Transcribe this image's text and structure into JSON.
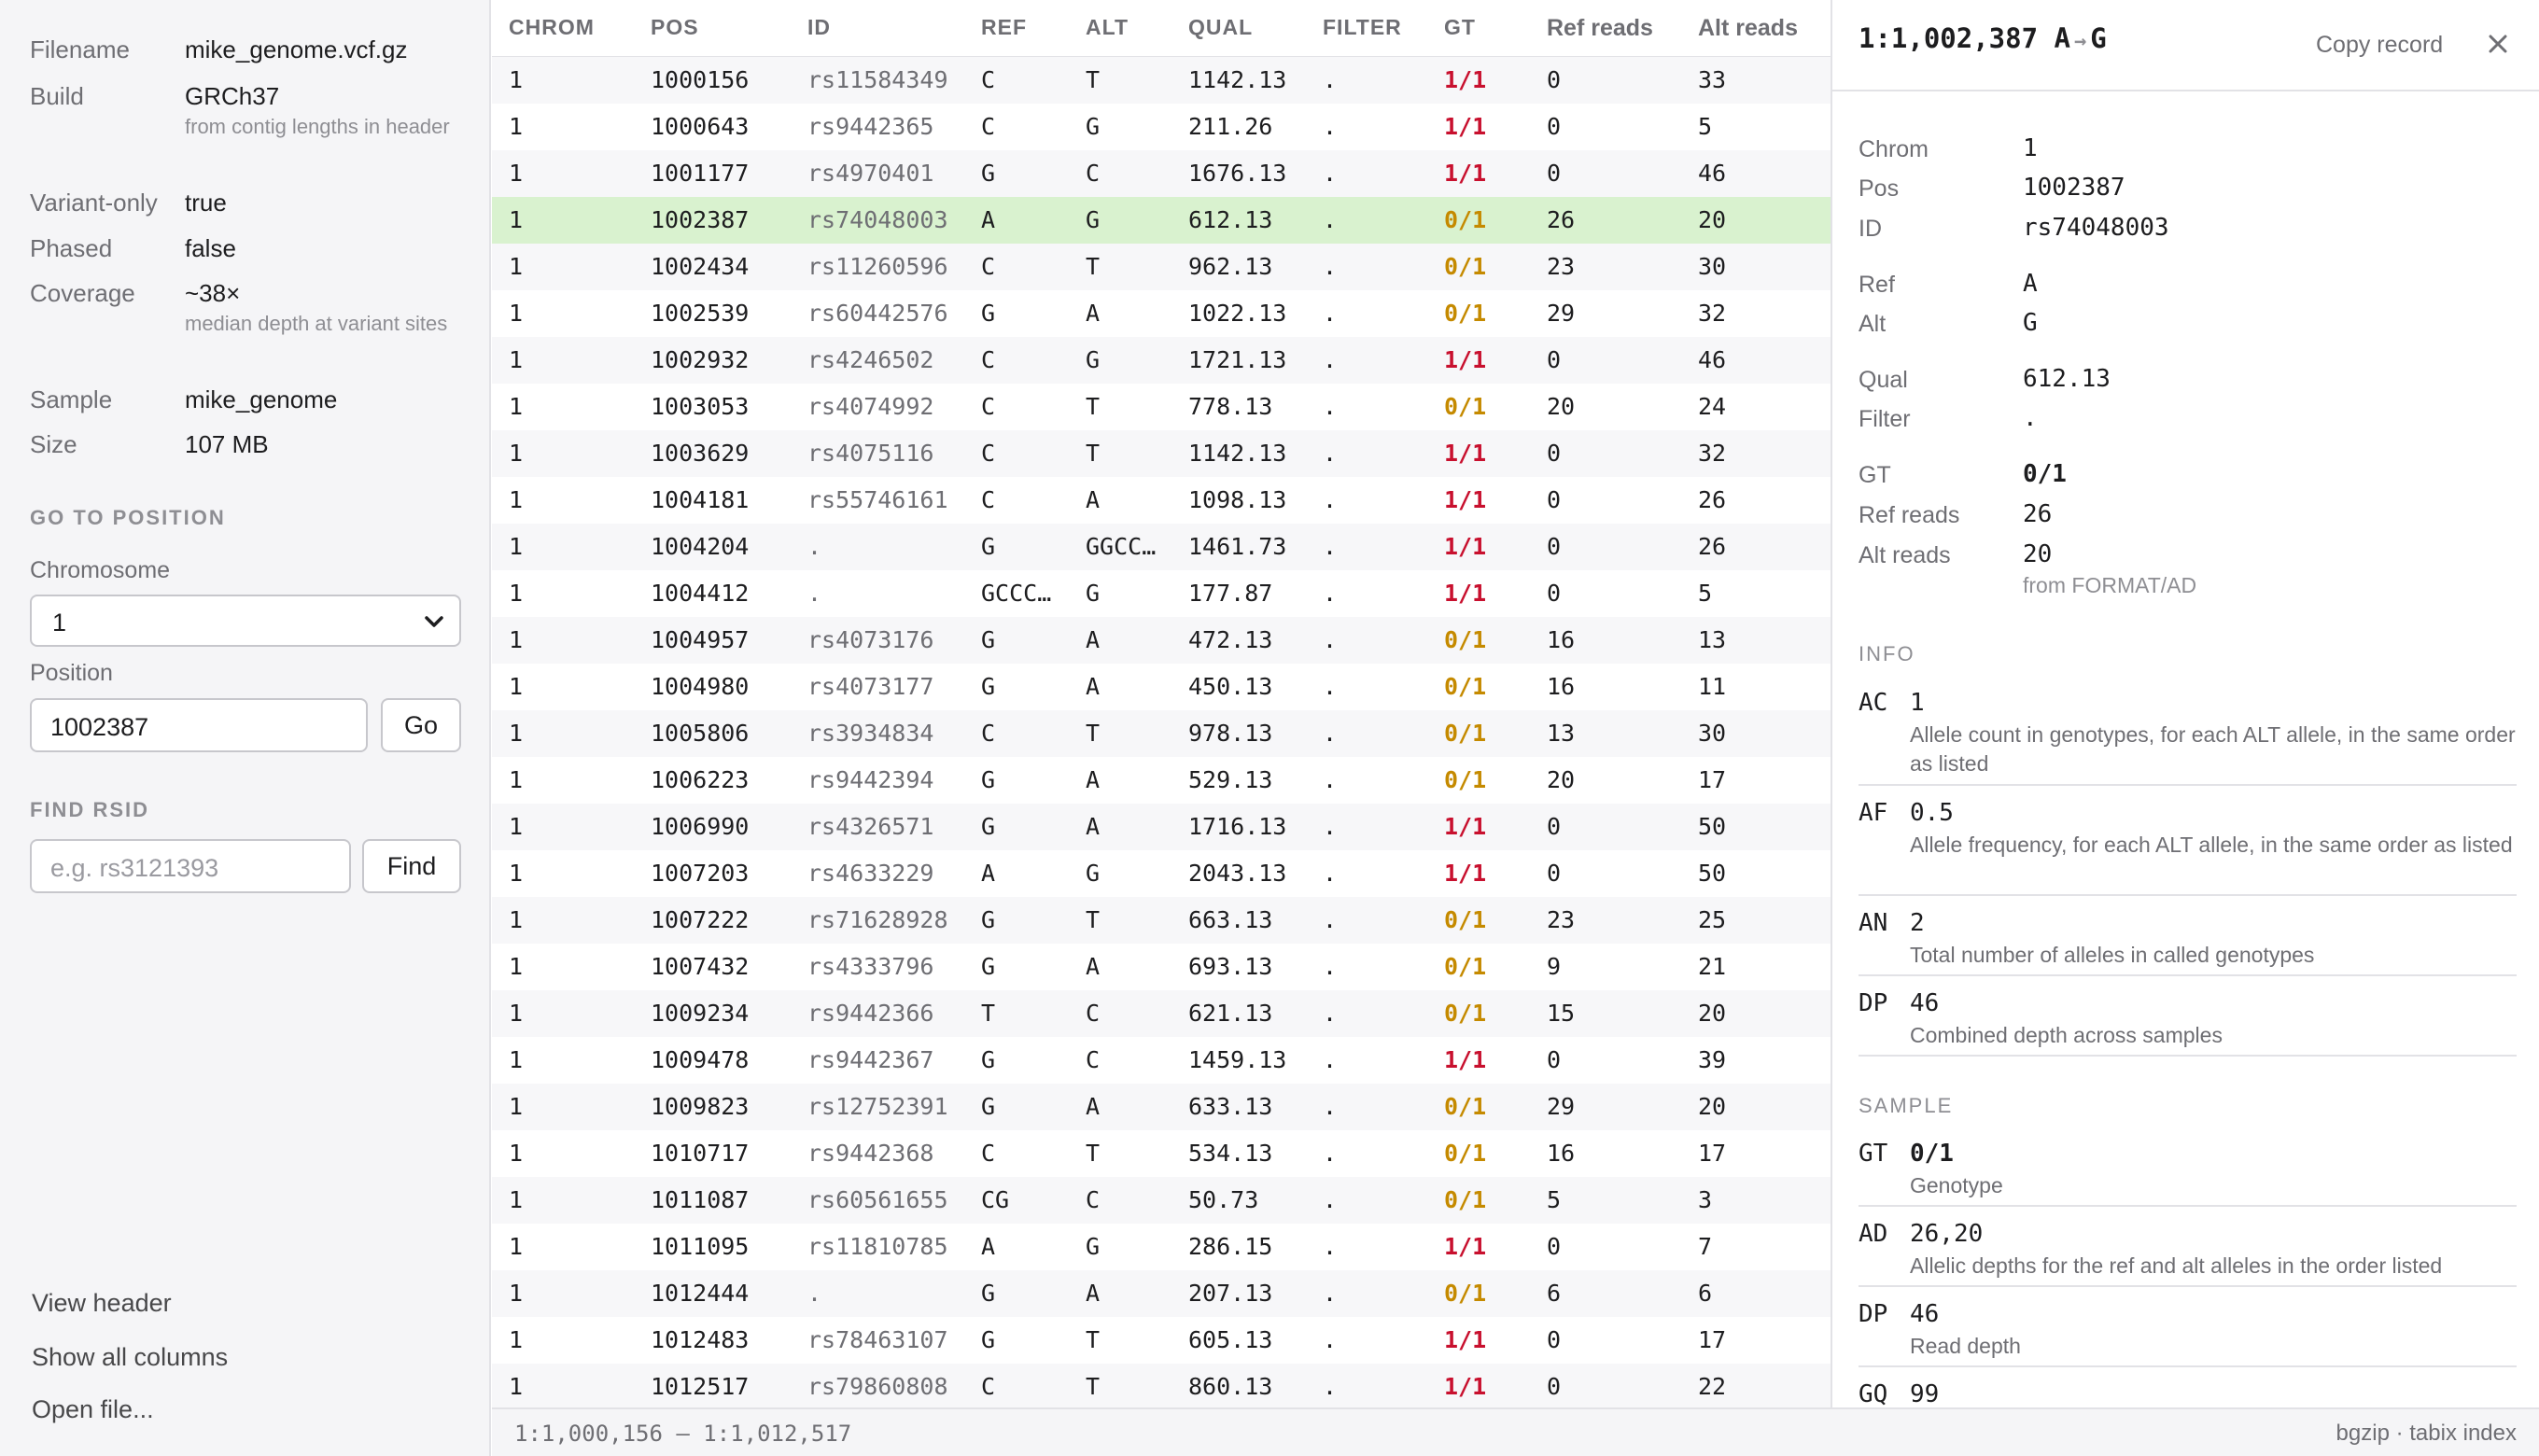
{
  "file": {
    "filename_label": "Filename",
    "filename": "mike_genome.vcf.gz",
    "build_label": "Build",
    "build": "GRCh37",
    "build_note": "from contig lengths in header",
    "variant_only_label": "Variant-only",
    "variant_only": "true",
    "phased_label": "Phased",
    "phased": "false",
    "coverage_label": "Coverage",
    "coverage": "~38×",
    "coverage_note": "median depth at variant sites",
    "sample_label": "Sample",
    "sample": "mike_genome",
    "size_label": "Size",
    "size": "107 MB"
  },
  "goto": {
    "heading": "GO TO POSITION",
    "chromosome_label": "Chromosome",
    "chromosome": "1",
    "position_label": "Position",
    "position": "1002387",
    "go_button": "Go"
  },
  "rsid": {
    "heading": "FIND RSID",
    "placeholder": "e.g. rs3121393",
    "find_button": "Find"
  },
  "sidebar_links": {
    "view_header": "View header",
    "show_all_columns": "Show all columns",
    "open_file": "Open file..."
  },
  "table": {
    "columns": [
      "CHROM",
      "POS",
      "ID",
      "REF",
      "ALT",
      "QUAL",
      "FILTER",
      "GT",
      "Ref reads",
      "Alt reads"
    ],
    "selected_index": 3,
    "rows": [
      [
        "1",
        "1000156",
        "rs11584349",
        "C",
        "T",
        "1142.13",
        ".",
        "1/1",
        "0",
        "33"
      ],
      [
        "1",
        "1000643",
        "rs9442365",
        "C",
        "G",
        "211.26",
        ".",
        "1/1",
        "0",
        "5"
      ],
      [
        "1",
        "1001177",
        "rs4970401",
        "G",
        "C",
        "1676.13",
        ".",
        "1/1",
        "0",
        "46"
      ],
      [
        "1",
        "1002387",
        "rs74048003",
        "A",
        "G",
        "612.13",
        ".",
        "0/1",
        "26",
        "20"
      ],
      [
        "1",
        "1002434",
        "rs11260596",
        "C",
        "T",
        "962.13",
        ".",
        "0/1",
        "23",
        "30"
      ],
      [
        "1",
        "1002539",
        "rs60442576",
        "G",
        "A",
        "1022.13",
        ".",
        "0/1",
        "29",
        "32"
      ],
      [
        "1",
        "1002932",
        "rs4246502",
        "C",
        "G",
        "1721.13",
        ".",
        "1/1",
        "0",
        "46"
      ],
      [
        "1",
        "1003053",
        "rs4074992",
        "C",
        "T",
        "778.13",
        ".",
        "0/1",
        "20",
        "24"
      ],
      [
        "1",
        "1003629",
        "rs4075116",
        "C",
        "T",
        "1142.13",
        ".",
        "1/1",
        "0",
        "32"
      ],
      [
        "1",
        "1004181",
        "rs55746161",
        "C",
        "A",
        "1098.13",
        ".",
        "1/1",
        "0",
        "26"
      ],
      [
        "1",
        "1004204",
        ".",
        "G",
        "GGCC…",
        "1461.73",
        ".",
        "1/1",
        "0",
        "26"
      ],
      [
        "1",
        "1004412",
        ".",
        "GCCC…",
        "G",
        "177.87",
        ".",
        "1/1",
        "0",
        "5"
      ],
      [
        "1",
        "1004957",
        "rs4073176",
        "G",
        "A",
        "472.13",
        ".",
        "0/1",
        "16",
        "13"
      ],
      [
        "1",
        "1004980",
        "rs4073177",
        "G",
        "A",
        "450.13",
        ".",
        "0/1",
        "16",
        "11"
      ],
      [
        "1",
        "1005806",
        "rs3934834",
        "C",
        "T",
        "978.13",
        ".",
        "0/1",
        "13",
        "30"
      ],
      [
        "1",
        "1006223",
        "rs9442394",
        "G",
        "A",
        "529.13",
        ".",
        "0/1",
        "20",
        "17"
      ],
      [
        "1",
        "1006990",
        "rs4326571",
        "G",
        "A",
        "1716.13",
        ".",
        "1/1",
        "0",
        "50"
      ],
      [
        "1",
        "1007203",
        "rs4633229",
        "A",
        "G",
        "2043.13",
        ".",
        "1/1",
        "0",
        "50"
      ],
      [
        "1",
        "1007222",
        "rs71628928",
        "G",
        "T",
        "663.13",
        ".",
        "0/1",
        "23",
        "25"
      ],
      [
        "1",
        "1007432",
        "rs4333796",
        "G",
        "A",
        "693.13",
        ".",
        "0/1",
        "9",
        "21"
      ],
      [
        "1",
        "1009234",
        "rs9442366",
        "T",
        "C",
        "621.13",
        ".",
        "0/1",
        "15",
        "20"
      ],
      [
        "1",
        "1009478",
        "rs9442367",
        "G",
        "C",
        "1459.13",
        ".",
        "1/1",
        "0",
        "39"
      ],
      [
        "1",
        "1009823",
        "rs12752391",
        "G",
        "A",
        "633.13",
        ".",
        "0/1",
        "29",
        "20"
      ],
      [
        "1",
        "1010717",
        "rs9442368",
        "C",
        "T",
        "534.13",
        ".",
        "0/1",
        "16",
        "17"
      ],
      [
        "1",
        "1011087",
        "rs60561655",
        "CG",
        "C",
        "50.73",
        ".",
        "0/1",
        "5",
        "3"
      ],
      [
        "1",
        "1011095",
        "rs11810785",
        "A",
        "G",
        "286.15",
        ".",
        "1/1",
        "0",
        "7"
      ],
      [
        "1",
        "1012444",
        ".",
        "G",
        "A",
        "207.13",
        ".",
        "0/1",
        "6",
        "6"
      ],
      [
        "1",
        "1012483",
        "rs78463107",
        "G",
        "T",
        "605.13",
        ".",
        "1/1",
        "0",
        "17"
      ],
      [
        "1",
        "1012517",
        "rs79860808",
        "C",
        "T",
        "860.13",
        ".",
        "1/1",
        "0",
        "22"
      ]
    ]
  },
  "status": {
    "range": "1:1,000,156 – 1:1,012,517",
    "format": "bgzip · tabix index"
  },
  "detail": {
    "title_pos": "1:1,002,387 A",
    "title_arrow": "→",
    "title_alt": "G",
    "copy_label": "Copy record",
    "chrom_label": "Chrom",
    "chrom": "1",
    "pos_label": "Pos",
    "pos": "1002387",
    "id_label": "ID",
    "id": "rs74048003",
    "ref_label": "Ref",
    "ref": "A",
    "alt_label": "Alt",
    "alt": "G",
    "qual_label": "Qual",
    "qual": "612.13",
    "filter_label": "Filter",
    "filter": ".",
    "gt_label": "GT",
    "gt": "0/1",
    "ref_reads_label": "Ref reads",
    "ref_reads": "26",
    "alt_reads_label": "Alt reads",
    "alt_reads": "20",
    "alt_reads_note": "from FORMAT/AD",
    "info_heading": "INFO",
    "info": [
      {
        "key": "AC",
        "value": "1",
        "desc": "Allele count in genotypes, for each ALT allele, in the same order as listed"
      },
      {
        "key": "AF",
        "value": "0.5",
        "desc": "Allele frequency, for each ALT allele, in the same order as listed"
      },
      {
        "key": "AN",
        "value": "2",
        "desc": "Total number of alleles in called genotypes"
      },
      {
        "key": "DP",
        "value": "46",
        "desc": "Combined depth across samples"
      }
    ],
    "sample_heading": "SAMPLE",
    "sample": [
      {
        "key": "GT",
        "value": "0/1",
        "desc": "Genotype"
      },
      {
        "key": "AD",
        "value": "26,20",
        "desc": "Allelic depths for the ref and alt alleles in the order listed"
      },
      {
        "key": "DP",
        "value": "46",
        "desc": "Read depth"
      },
      {
        "key": "GQ",
        "value": "99",
        "desc": ""
      }
    ]
  },
  "colors": {
    "het": "#c58a00",
    "hom_alt": "#c8102e",
    "selected_row": "#d9f2cf"
  }
}
